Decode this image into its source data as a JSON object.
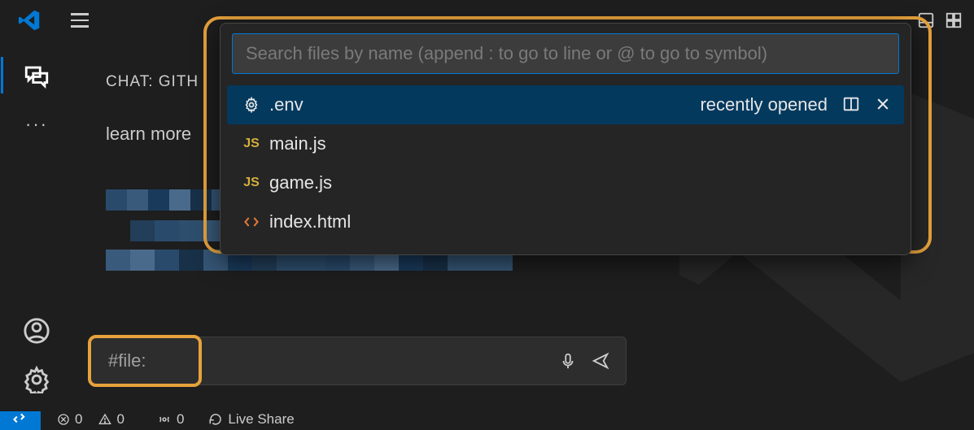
{
  "titlebar": {},
  "activity": {},
  "sidebar": {
    "chat_header": "CHAT: GITH",
    "chat_text": "learn more"
  },
  "chat_input": {
    "value": "#file:"
  },
  "quickopen": {
    "placeholder": "Search files by name (append : to go to line or @ to go to symbol)",
    "selected_hint": "recently opened",
    "items": [
      {
        "label": ".env",
        "icon": "gear"
      },
      {
        "label": "main.js",
        "icon": "js"
      },
      {
        "label": "game.js",
        "icon": "js"
      },
      {
        "label": "index.html",
        "icon": "html"
      }
    ]
  },
  "status": {
    "errors": "0",
    "warnings": "0",
    "ports": "0",
    "live_share": "Live Share"
  }
}
